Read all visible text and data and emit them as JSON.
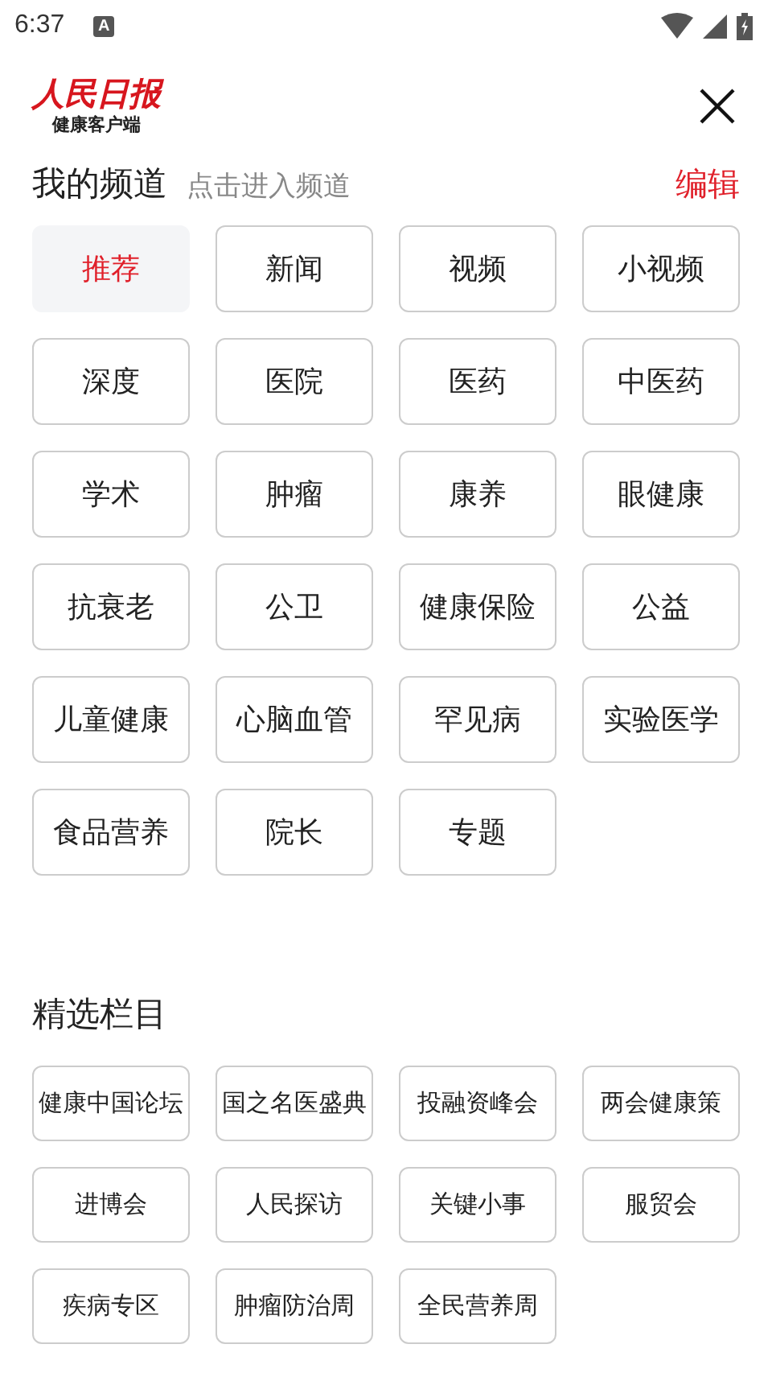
{
  "status_bar": {
    "time": "6:37",
    "notification": "A"
  },
  "header": {
    "logo_title": "人民日报",
    "logo_subtitle": "健康客户端"
  },
  "my_channels": {
    "title": "我的频道",
    "hint": "点击进入频道",
    "edit": "编辑",
    "items": [
      {
        "label": "推荐",
        "selected": true
      },
      {
        "label": "新闻",
        "selected": false
      },
      {
        "label": "视频",
        "selected": false
      },
      {
        "label": "小视频",
        "selected": false
      },
      {
        "label": "深度",
        "selected": false
      },
      {
        "label": "医院",
        "selected": false
      },
      {
        "label": "医药",
        "selected": false
      },
      {
        "label": "中医药",
        "selected": false
      },
      {
        "label": "学术",
        "selected": false
      },
      {
        "label": "肿瘤",
        "selected": false
      },
      {
        "label": "康养",
        "selected": false
      },
      {
        "label": "眼健康",
        "selected": false
      },
      {
        "label": "抗衰老",
        "selected": false
      },
      {
        "label": "公卫",
        "selected": false
      },
      {
        "label": "健康保险",
        "selected": false
      },
      {
        "label": "公益",
        "selected": false
      },
      {
        "label": "儿童健康",
        "selected": false
      },
      {
        "label": "心脑血管",
        "selected": false
      },
      {
        "label": "罕见病",
        "selected": false
      },
      {
        "label": "实验医学",
        "selected": false
      },
      {
        "label": "食品营养",
        "selected": false
      },
      {
        "label": "院长",
        "selected": false
      },
      {
        "label": "专题",
        "selected": false
      }
    ]
  },
  "featured": {
    "title": "精选栏目",
    "items": [
      "健康中国论坛",
      "国之名医盛典",
      "投融资峰会",
      "两会健康策",
      "进博会",
      "人民探访",
      "关键小事",
      "服贸会",
      "疾病专区",
      "肿瘤防治周",
      "全民营养周"
    ]
  }
}
